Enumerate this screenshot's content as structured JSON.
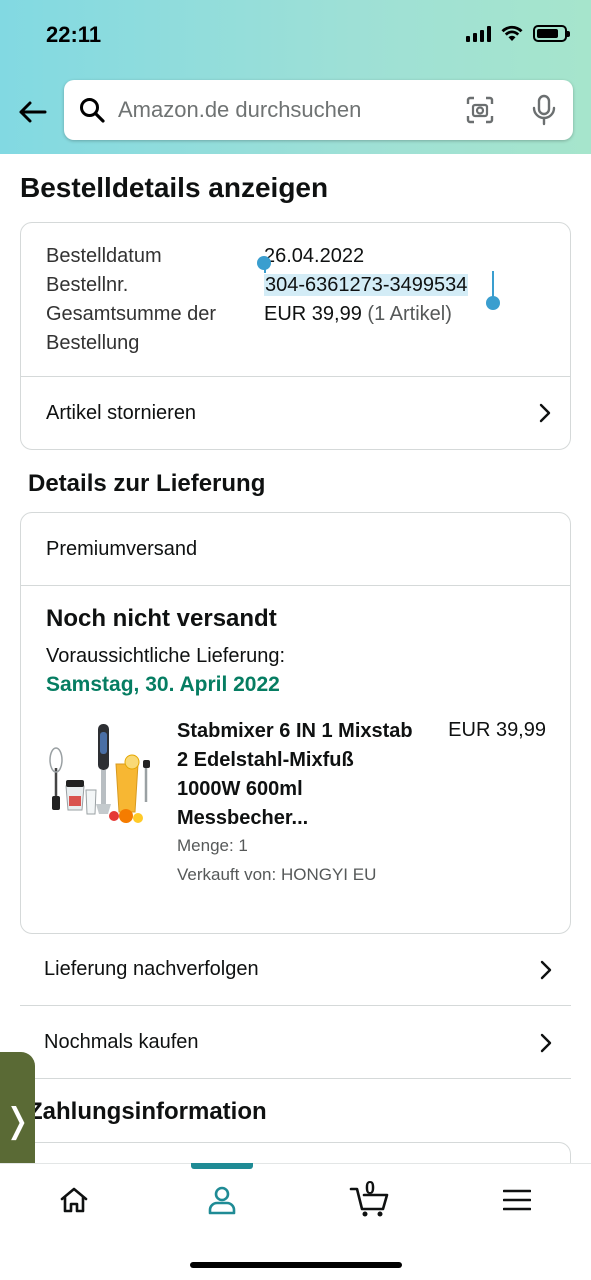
{
  "status_bar": {
    "time": "22:11"
  },
  "search": {
    "placeholder": "Amazon.de durchsuchen"
  },
  "page": {
    "title": "Bestelldetails anzeigen"
  },
  "order": {
    "date_label": "Bestelldatum",
    "date_value": "26.04.2022",
    "number_label": "Bestellnr.",
    "number_value": "304-6361273-3499534",
    "total_label_line1": "Gesamtsumme der",
    "total_label_line2": "Bestellung",
    "total_value": "EUR 39,99",
    "total_items": "(1 Artikel)",
    "cancel_label": "Artikel stornieren"
  },
  "delivery": {
    "section_title": "Details zur Lieferung",
    "shipping_type": "Premiumversand",
    "status": "Noch nicht versandt",
    "eta_label": "Voraussichtliche Lieferung:",
    "eta_date": "Samstag, 30. April 2022",
    "product": {
      "title": "Stabmixer 6 IN 1 Mixstab 2 Edelstahl-Mixfuß 1000W 600ml Messbecher...",
      "price": "EUR 39,99",
      "quantity": "Menge: 1",
      "seller": "Verkauft von: HONGYI EU"
    }
  },
  "actions": {
    "track": "Lieferung nachverfolgen",
    "buy_again": "Nochmals kaufen"
  },
  "payment": {
    "section_title": "Zahlungsinformation"
  },
  "side_handle": {
    "glyph": "❭"
  },
  "bottom_nav": {
    "active": "account",
    "cart_count": "0",
    "active_color": "#1f8b95"
  },
  "colors": {
    "eta_green": "#067d62",
    "selection_blue": "#3a9ecf",
    "selection_bg": "#d3ecf6"
  }
}
